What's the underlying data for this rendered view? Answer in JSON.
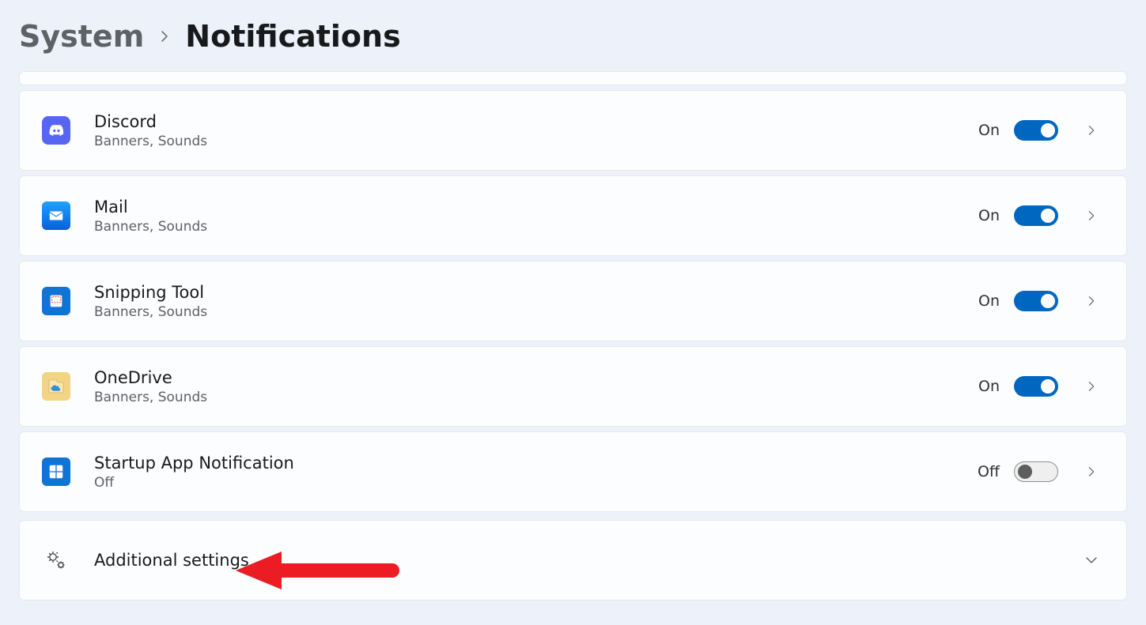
{
  "breadcrumb": {
    "parent": "System",
    "title": "Notifications"
  },
  "apps": [
    {
      "id": "discord",
      "name": "Discord",
      "sub": "Banners, Sounds",
      "state": "On",
      "on": true
    },
    {
      "id": "mail",
      "name": "Mail",
      "sub": "Banners, Sounds",
      "state": "On",
      "on": true
    },
    {
      "id": "snipping-tool",
      "name": "Snipping Tool",
      "sub": "Banners, Sounds",
      "state": "On",
      "on": true
    },
    {
      "id": "onedrive",
      "name": "OneDrive",
      "sub": "Banners, Sounds",
      "state": "On",
      "on": true
    },
    {
      "id": "startup-app-notification",
      "name": "Startup App Notification",
      "sub": "Off",
      "state": "Off",
      "on": false
    }
  ],
  "additional": {
    "label": "Additional settings"
  }
}
